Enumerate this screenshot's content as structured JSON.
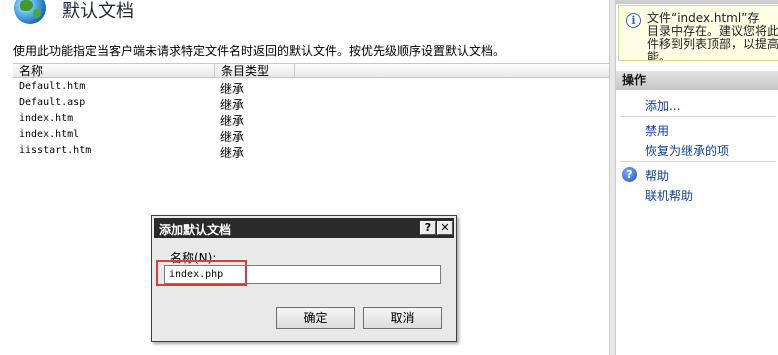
{
  "main": {
    "title": "默认文档",
    "description": "使用此功能指定当客户端未请求特定文件名时返回的默认文件。按优先级顺序设置默认文档。",
    "columns": {
      "name": "名称",
      "type": "条目类型"
    },
    "rows": [
      {
        "name": "Default.htm",
        "type": "继承"
      },
      {
        "name": "Default.asp",
        "type": "继承"
      },
      {
        "name": "index.htm",
        "type": "继承"
      },
      {
        "name": "index.html",
        "type": "继承"
      },
      {
        "name": "iisstart.htm",
        "type": "继承"
      }
    ]
  },
  "alert": {
    "icon": "info-icon",
    "lines": [
      "文件“index.html”存",
      "目录中存在。建议您将此",
      "件移到列表顶部，以提高",
      "能。"
    ]
  },
  "actions": {
    "header": "操作",
    "add": "添加...",
    "disable": "禁用",
    "revert": "恢复为继承的项",
    "help": "帮助",
    "online_help": "联机帮助",
    "help_icon": "help-icon"
  },
  "dialog": {
    "title": "添加默认文档",
    "help_glyph": "?",
    "close_glyph": "✕",
    "name_label": "名称(N):",
    "name_value": "index.php",
    "ok": "确定",
    "cancel": "取消"
  },
  "colors": {
    "link": "#0e3fa0",
    "highlight": "#e23a3a",
    "alert_background": "#fffde4",
    "dialog_titlebar": "#2a2a2a"
  }
}
